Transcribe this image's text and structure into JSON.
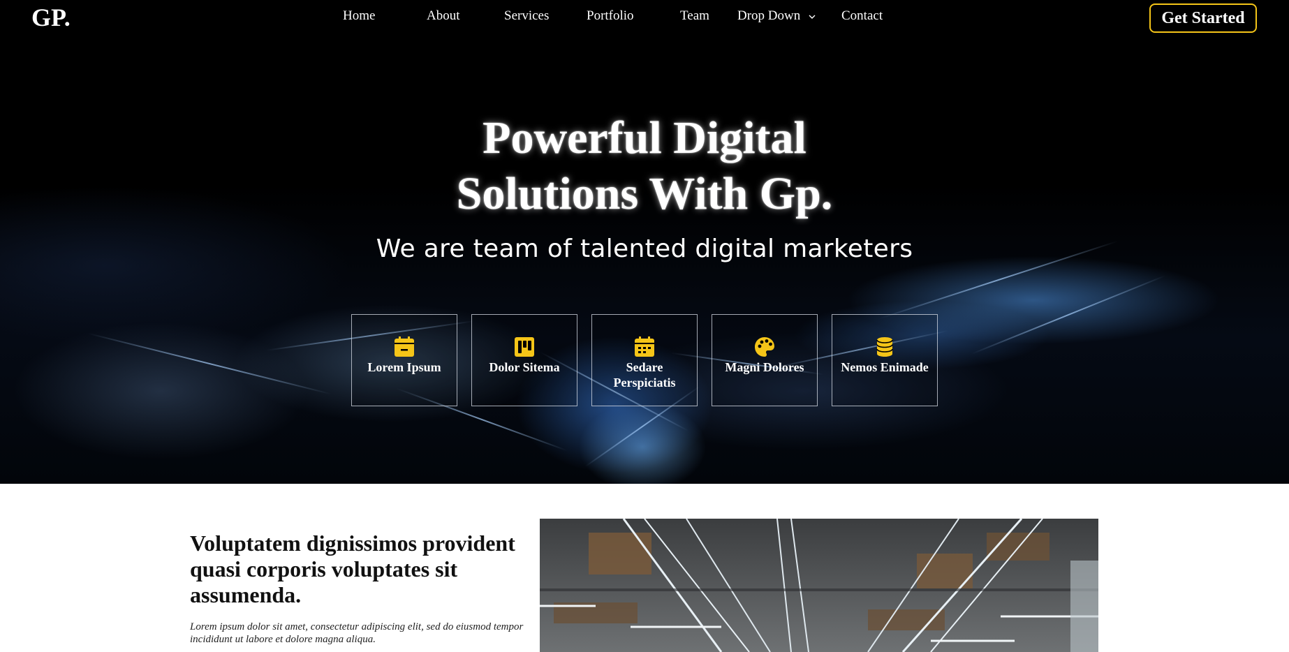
{
  "header": {
    "logo": "GP.",
    "nav": [
      {
        "label": "Home"
      },
      {
        "label": "About"
      },
      {
        "label": "Services"
      },
      {
        "label": "Portfolio"
      },
      {
        "label": "Team"
      },
      {
        "label": "Drop Down",
        "icon": "chevron-down-icon"
      },
      {
        "label": "Contact"
      }
    ],
    "cta_label": "Get Started",
    "cta_border_color": "#f5c518"
  },
  "hero": {
    "title_line1": "Powerful Digital",
    "title_line2": "Solutions With Gp.",
    "subtitle": "We are team of talented digital marketers",
    "features": [
      {
        "label": "Lorem Ipsum",
        "icon": "calendar-minus-icon"
      },
      {
        "label": "Dolor Sitema",
        "icon": "kanban-icon"
      },
      {
        "label": "Sedare Perspiciatis",
        "icon": "calendar-grid-icon"
      },
      {
        "label": "Magni Dolores",
        "icon": "palette-icon"
      },
      {
        "label": "Nemos Enimade",
        "icon": "database-icon"
      }
    ],
    "icon_color": "#f5c518"
  },
  "about": {
    "heading": "Voluptatem dignissimos provident quasi corporis voluptates sit assumenda.",
    "text": "Lorem ipsum dolor sit amet, consectetur adipiscing elit, sed do eiusmod tempor incididunt ut labore et dolore magna aliqua.",
    "image": "office-interior-photo"
  }
}
